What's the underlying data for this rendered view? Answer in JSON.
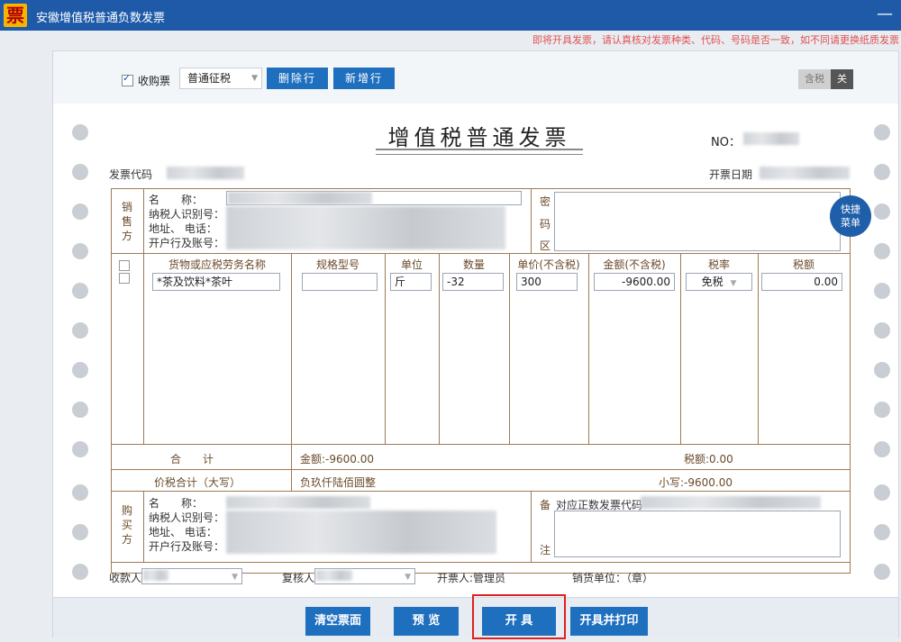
{
  "window": {
    "logo_char": "票",
    "title": "安徽增值税普通负数发票",
    "minimize": "—"
  },
  "warning": "即将开具发票，请认真核对发票种类、代码、号码是否一致，如不同请更换纸质发票",
  "toolbar": {
    "purchase_label": "收购票",
    "purchase_checked": true,
    "levy_type": "普通征税",
    "delete_row": "删除行",
    "add_row": "新增行",
    "tax_included": "含税",
    "tax_toggle_state": "关"
  },
  "invoice": {
    "title": "增值税普通发票",
    "no_label": "NO：",
    "code_label": "发票代码",
    "date_label": "开票日期",
    "seller": {
      "side_label": "销售方",
      "name_label": "名　　称：",
      "taxid_label": "纳税人识别号：",
      "address_label": "地址、 电话：",
      "bank_label": "开户行及账号："
    },
    "cipher": {
      "c1": "密",
      "c2": "码",
      "c3": "区"
    },
    "columns": [
      "货物或应税劳务名称",
      "规格型号",
      "单位",
      "数量",
      "单价(不含税)",
      "金额(不含税)",
      "税率",
      "税额"
    ],
    "items": [
      {
        "name": "*茶及饮料*茶叶",
        "spec": "",
        "unit": "斤",
        "qty": "-32",
        "price": "300",
        "amount": "-9600.00",
        "rate": "免税",
        "tax": "0.00"
      }
    ],
    "total": {
      "label": "合　　计",
      "amount": "金额:-9600.00",
      "tax": "税额:0.00"
    },
    "grand_total": {
      "label": "价税合计（大写）",
      "words": "负玖仟陆佰圆整",
      "small": "小写:-9600.00"
    },
    "buyer": {
      "side_label": "购买方",
      "name_label": "名　　称：",
      "taxid_label": "纳税人识别号：",
      "address_label": "地址、 电话：",
      "bank_label": "开户行及账号："
    },
    "remarks": {
      "b1": "备",
      "b2": "注",
      "text": "对应正数发票代码"
    },
    "bottom": {
      "payee": "收款人",
      "reviewer": "复核人",
      "issuer": "开票人:管理员",
      "seller_unit": "销货单位：（章）"
    }
  },
  "quick_menu": "快捷菜单",
  "footer": {
    "clear": "清空票面",
    "preview": "预 览",
    "issue": "开 具",
    "issue_print": "开具并打印"
  }
}
